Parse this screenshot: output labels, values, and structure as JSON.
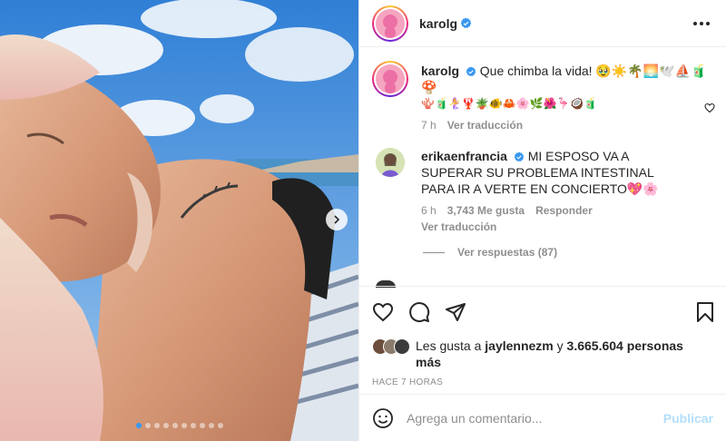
{
  "post": {
    "author": "karolg",
    "verified": true
  },
  "caption": {
    "username": "karolg",
    "text": "Que chimba la vida! 🥹☀️🌴🌅🕊️⛵️🧃🍄",
    "text_line2": "🪸🧃🧜‍♀️🦞🪴🐠🦀🌸🌿🌺🦩🥥🧃",
    "time": "7 h",
    "translate": "Ver traducción"
  },
  "comment": {
    "username": "erikaenfrancia",
    "text": "MI ESPOSO VA A SUPERAR SU PROBLEMA INTESTINAL PARA IR A VERTE EN CONCIERTO💖🌸",
    "time": "6 h",
    "likes": "3,743 Me gusta",
    "reply": "Responder",
    "translate": "Ver traducción",
    "view_replies": "Ver respuestas (87)"
  },
  "likes": {
    "prefix": "Les gusta a",
    "user": "jaylennezm",
    "mid": "y",
    "count": "3.665.604 personas",
    "suffix": "más"
  },
  "timestamp": "HACE 7 HORAS",
  "add_comment": {
    "placeholder": "Agrega un comentario...",
    "publish": "Publicar"
  },
  "carousel": {
    "total": 10,
    "active_index": 0
  },
  "icons": {
    "verified": "verified-badge-icon",
    "more": "more-options-icon",
    "like": "heart-icon",
    "comment": "comment-icon",
    "share": "send-icon",
    "save": "bookmark-icon",
    "emoji": "emoji-icon",
    "next": "chevron-right-icon"
  },
  "colors": {
    "verified": "#3897f0",
    "publish_disabled": "#b2dffc",
    "secondary_text": "#8e8e8e",
    "carousel_active": "#3897f0"
  }
}
